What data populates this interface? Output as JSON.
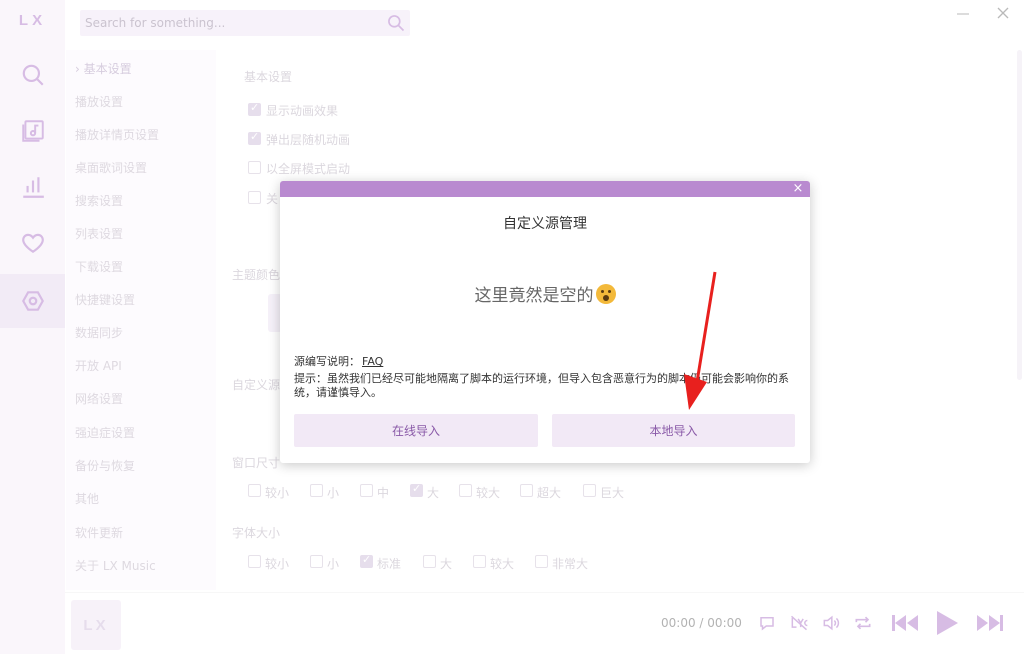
{
  "app": {
    "logo": "LX"
  },
  "nav": {
    "icons": [
      "search-icon",
      "music-library-icon",
      "chart-icon",
      "heart-icon",
      "settings-icon"
    ],
    "active": "settings-icon",
    "accent": "#a76bc4"
  },
  "search": {
    "placeholder": "Search for something..."
  },
  "settings_menu": [
    "基本设置",
    "播放设置",
    "播放详情页设置",
    "桌面歌词设置",
    "搜索设置",
    "列表设置",
    "下载设置",
    "快捷键设置",
    "数据同步",
    "开放 API",
    "网络设置",
    "强迫症设置",
    "备份与恢复",
    "其他",
    "软件更新",
    "关于 LX Music"
  ],
  "content": {
    "section_title": "基本设置",
    "options": [
      {
        "label": "显示动画效果",
        "checked": true
      },
      {
        "label": "弹出层随机动画",
        "checked": true
      },
      {
        "label": "以全屏模式启动",
        "checked": false
      },
      {
        "label": "关",
        "checked": false
      }
    ],
    "theme_label": "主题颜色",
    "custom_source_label": "自定义源",
    "window_size_label": "窗口尺寸",
    "window_sizes": [
      {
        "label": "较小",
        "checked": false
      },
      {
        "label": "小",
        "checked": false
      },
      {
        "label": "中",
        "checked": false
      },
      {
        "label": "大",
        "checked": true
      },
      {
        "label": "较大",
        "checked": false
      },
      {
        "label": "超大",
        "checked": false
      },
      {
        "label": "巨大",
        "checked": false
      }
    ],
    "font_size_label": "字体大小",
    "font_sizes": [
      {
        "label": "较小",
        "checked": false
      },
      {
        "label": "小",
        "checked": false
      },
      {
        "label": "标准",
        "checked": true
      },
      {
        "label": "大",
        "checked": false
      },
      {
        "label": "较大",
        "checked": false
      },
      {
        "label": "非常大",
        "checked": false
      }
    ]
  },
  "modal": {
    "title": "自定义源管理",
    "empty_message": "这里竟然是空的",
    "emoji": "astonished-face-emoji",
    "doc_label": "源编写说明：",
    "doc_link": "FAQ",
    "tip": "提示：虽然我们已经尽可能地隔离了脚本的运行环境，但导入包含恶意行为的脚本仍可能会影响你的系统，请谨慎导入。",
    "online_import": "在线导入",
    "local_import": "本地导入",
    "header_color": "#b98ad0"
  },
  "player": {
    "cover_text": "LX",
    "current_time": "00:00",
    "separator": "/",
    "total_time": "00:00",
    "controls": [
      "comment-icon",
      "lyrics-off-icon",
      "volume-icon",
      "repeat-icon",
      "previous-icon",
      "play-icon",
      "next-icon"
    ]
  },
  "annotation": {
    "arrow_color": "#e8201e"
  }
}
